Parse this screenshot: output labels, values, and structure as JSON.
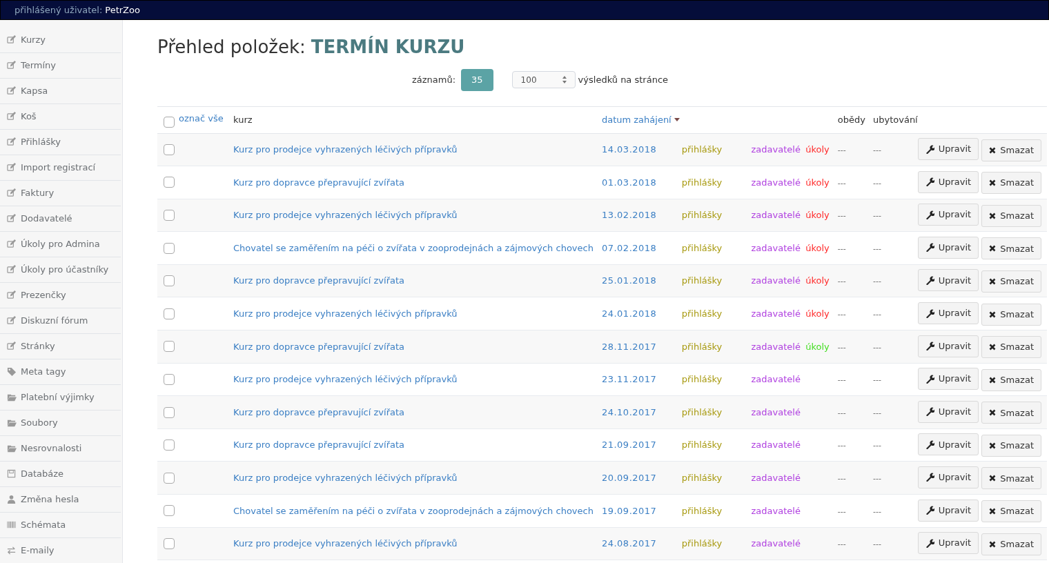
{
  "top_bar": {
    "label": "přihlášený uživatel:",
    "user": "PetrZoo"
  },
  "sidebar": {
    "items": [
      {
        "label": "Kurzy",
        "kind": "edit"
      },
      {
        "label": "Termíny",
        "kind": "edit"
      },
      {
        "label": "Kapsa",
        "kind": "edit"
      },
      {
        "label": "Koš",
        "kind": "edit"
      },
      {
        "label": "Přihlášky",
        "kind": "edit"
      },
      {
        "label": "Import registrací",
        "kind": "edit"
      },
      {
        "label": "Faktury",
        "kind": "edit"
      },
      {
        "label": "Dodavatelé",
        "kind": "edit"
      },
      {
        "label": "Úkoly pro Admina",
        "kind": "edit"
      },
      {
        "label": "Úkoly pro účastníky",
        "kind": "edit"
      },
      {
        "label": "Prezenčky",
        "kind": "edit"
      },
      {
        "label": "Diskuzní fórum",
        "kind": "edit"
      },
      {
        "label": "Stránky",
        "kind": "edit"
      },
      {
        "label": "Meta tagy",
        "kind": "tags"
      },
      {
        "label": "Platební výjimky",
        "kind": "folder"
      },
      {
        "label": "Soubory",
        "kind": "folder"
      },
      {
        "label": "Nesrovnalosti",
        "kind": "folder"
      },
      {
        "label": "Databáze",
        "kind": "save"
      },
      {
        "label": "Změna hesla",
        "kind": "user"
      },
      {
        "label": "Schémata",
        "kind": "barcode"
      },
      {
        "label": "E-maily",
        "kind": "exchange"
      }
    ]
  },
  "heading": {
    "prefix": "Přehled položek:",
    "title": "TERMÍN KURZU"
  },
  "toolbar": {
    "count_label": "záznamů:",
    "count": "35",
    "per_page": "100",
    "per_page_label": "výsledků na stránce"
  },
  "table": {
    "select_all_checked": false,
    "columns": {
      "select_all": "označ vše",
      "course": "kurz",
      "start_date": "datum zahájení",
      "lunches": "obědy",
      "accommodation": "ubytování"
    },
    "rows": [
      {
        "checked": false,
        "course": "Kurz pro prodejce vyhrazených léčivých přípravků",
        "date": "14.03.2018",
        "applications": "přihlášky",
        "sponsors": "zadavatelé",
        "tasks": {
          "label": "úkoly",
          "color": "#ff2a2a"
        },
        "lunches": "---",
        "accommodation": "---",
        "edit": "Upravit",
        "delete": "Smazat"
      },
      {
        "checked": false,
        "course": "Kurz pro dopravce přepravující zvířata",
        "date": "01.03.2018",
        "applications": "přihlášky",
        "sponsors": "zadavatelé",
        "tasks": {
          "label": "úkoly",
          "color": "#ff2a2a"
        },
        "lunches": "---",
        "accommodation": "---",
        "edit": "Upravit",
        "delete": "Smazat"
      },
      {
        "checked": false,
        "course": "Kurz pro prodejce vyhrazených léčivých přípravků",
        "date": "13.02.2018",
        "applications": "přihlášky",
        "sponsors": "zadavatelé",
        "tasks": {
          "label": "úkoly",
          "color": "#ff2a2a"
        },
        "lunches": "---",
        "accommodation": "---",
        "edit": "Upravit",
        "delete": "Smazat"
      },
      {
        "checked": false,
        "course": "Chovatel se zaměřením na péči o zvířata v zooprodejnách a zájmových chovech",
        "date": "07.02.2018",
        "applications": "přihlášky",
        "sponsors": "zadavatelé",
        "tasks": {
          "label": "úkoly",
          "color": "#ff2a2a"
        },
        "lunches": "---",
        "accommodation": "---",
        "edit": "Upravit",
        "delete": "Smazat"
      },
      {
        "checked": false,
        "course": "Kurz pro dopravce přepravující zvířata",
        "date": "25.01.2018",
        "applications": "přihlášky",
        "sponsors": "zadavatelé",
        "tasks": {
          "label": "úkoly",
          "color": "#ff2a2a"
        },
        "lunches": "---",
        "accommodation": "---",
        "edit": "Upravit",
        "delete": "Smazat"
      },
      {
        "checked": false,
        "course": "Kurz pro prodejce vyhrazených léčivých přípravků",
        "date": "24.01.2018",
        "applications": "přihlášky",
        "sponsors": "zadavatelé",
        "tasks": {
          "label": "úkoly",
          "color": "#ff2a2a"
        },
        "lunches": "---",
        "accommodation": "---",
        "edit": "Upravit",
        "delete": "Smazat"
      },
      {
        "checked": false,
        "course": "Kurz pro dopravce přepravující zvířata",
        "date": "28.11.2017",
        "applications": "přihlášky",
        "sponsors": "zadavatelé",
        "tasks": {
          "label": "úkoly",
          "color": "#44dd22"
        },
        "lunches": "---",
        "accommodation": "---",
        "edit": "Upravit",
        "delete": "Smazat"
      },
      {
        "checked": false,
        "course": "Kurz pro prodejce vyhrazených léčivých přípravků",
        "date": "23.11.2017",
        "applications": "přihlášky",
        "sponsors": "zadavatelé",
        "lunches": "---",
        "accommodation": "---",
        "edit": "Upravit",
        "delete": "Smazat"
      },
      {
        "checked": false,
        "course": "Kurz pro dopravce přepravující zvířata",
        "date": "24.10.2017",
        "applications": "přihlášky",
        "sponsors": "zadavatelé",
        "lunches": "---",
        "accommodation": "---",
        "edit": "Upravit",
        "delete": "Smazat"
      },
      {
        "checked": false,
        "course": "Kurz pro dopravce přepravující zvířata",
        "date": "21.09.2017",
        "applications": "přihlášky",
        "sponsors": "zadavatelé",
        "lunches": "---",
        "accommodation": "---",
        "edit": "Upravit",
        "delete": "Smazat"
      },
      {
        "checked": false,
        "course": "Kurz pro prodejce vyhrazených léčivých přípravků",
        "date": "20.09.2017",
        "applications": "přihlášky",
        "sponsors": "zadavatelé",
        "lunches": "---",
        "accommodation": "---",
        "edit": "Upravit",
        "delete": "Smazat"
      },
      {
        "checked": false,
        "course": "Chovatel se zaměřením na péči o zvířata v zooprodejnách a zájmových chovech",
        "date": "19.09.2017",
        "applications": "přihlášky",
        "sponsors": "zadavatelé",
        "lunches": "---",
        "accommodation": "---",
        "edit": "Upravit",
        "delete": "Smazat"
      },
      {
        "checked": false,
        "course": "Kurz pro prodejce vyhrazených léčivých přípravků",
        "date": "24.08.2017",
        "applications": "přihlášky",
        "sponsors": "zadavatelé",
        "lunches": "---",
        "accommodation": "---",
        "edit": "Upravit",
        "delete": "Smazat"
      }
    ]
  }
}
